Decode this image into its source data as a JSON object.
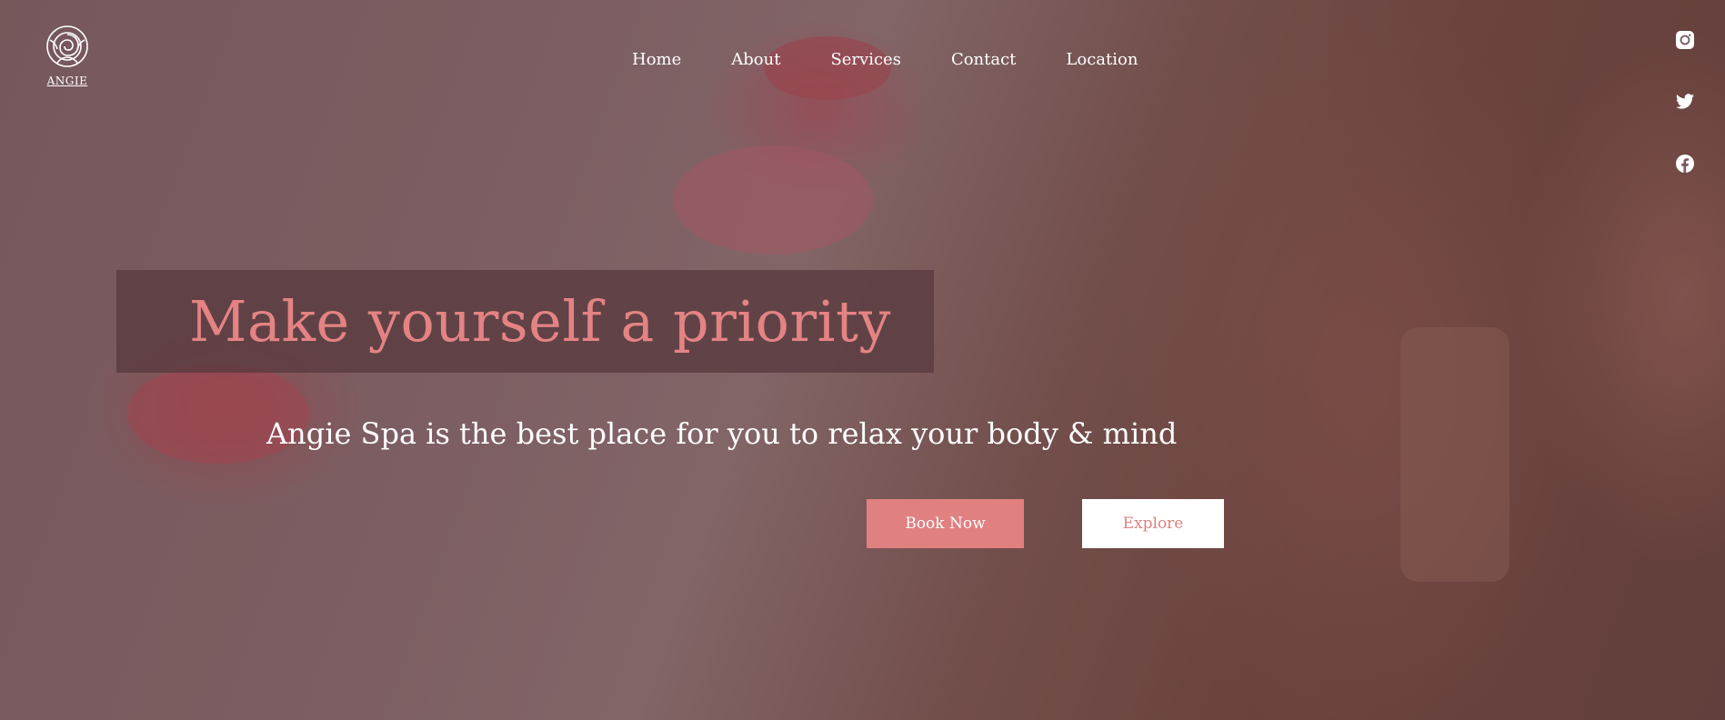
{
  "brand": {
    "name": "ANGIE",
    "logo_icon": "rose-icon"
  },
  "nav": {
    "items": [
      {
        "label": "Home"
      },
      {
        "label": "About"
      },
      {
        "label": "Services"
      },
      {
        "label": "Contact"
      },
      {
        "label": "Location"
      }
    ]
  },
  "social": [
    {
      "icon": "instagram-icon"
    },
    {
      "icon": "twitter-icon"
    },
    {
      "icon": "facebook-icon"
    }
  ],
  "hero": {
    "title": "Make yourself a priority",
    "subtitle": "Angie Spa is the best place for you to relax your body & mind",
    "primary_button": "Book Now",
    "secondary_button": "Explore"
  },
  "colors": {
    "accent": "#e08080",
    "title": "#e48383",
    "band": "#5a3c41",
    "text": "#ffffff"
  }
}
